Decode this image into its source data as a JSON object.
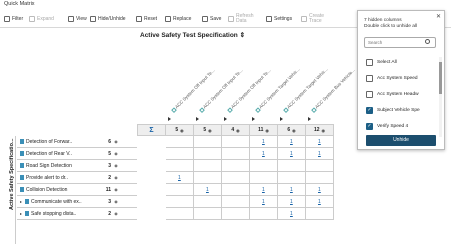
{
  "window": {
    "title": "Quick Matrix"
  },
  "toolbar": {
    "items": [
      {
        "label": "Filter",
        "icon": "filter-icon",
        "enabled": true
      },
      {
        "label": "Expand",
        "icon": "expand-icon",
        "enabled": false
      },
      {
        "label": "View",
        "icon": "view-icon",
        "enabled": true
      },
      {
        "label": "Hide/Unhide",
        "icon": "eye-slash-icon",
        "enabled": true
      },
      {
        "label": "Reset",
        "icon": "reset-icon",
        "enabled": true
      },
      {
        "label": "Replace",
        "icon": "replace-icon",
        "enabled": true
      },
      {
        "label": "Save",
        "icon": "save-icon",
        "enabled": true
      },
      {
        "label": "Refresh Data",
        "icon": "refresh-icon",
        "enabled": false
      },
      {
        "label": "Settings",
        "icon": "gear-icon",
        "enabled": true
      },
      {
        "label": "Create Trace",
        "icon": "trace-icon",
        "enabled": false
      }
    ]
  },
  "matrix": {
    "column_spec_title": "Active Safety Test Specification",
    "column_labels": [
      "ACC System Off Input Te...",
      "ACC System Off Input Te...",
      "ACC System Off Input Te...",
      "ACC System Target Vehic...",
      "ACC System Target Vehic...",
      "ACC System Bus Vehicle..."
    ],
    "column_counts": [
      "5",
      "5",
      "4",
      "11",
      "6",
      "12"
    ],
    "sigma": "Σ",
    "row_axis_label": "Active Safety Specificatio...",
    "rows": [
      {
        "name": "Detection of Forwar..",
        "count": "6",
        "expander": ""
      },
      {
        "name": "Detection of Rear V..",
        "count": "5",
        "expander": ""
      },
      {
        "name": "Road Sign Detection",
        "count": "3",
        "expander": ""
      },
      {
        "name": "Provide alert to dr..",
        "count": "2",
        "expander": ""
      },
      {
        "name": "Collision Detection",
        "count": "11",
        "expander": ""
      },
      {
        "name": "Communicate with ex..",
        "count": "3",
        "expander": "▸"
      },
      {
        "name": "Safe stopping dista..",
        "count": "2",
        "expander": "▸"
      }
    ],
    "cell_values": [
      {
        "row": 0,
        "col": 3,
        "value": "1"
      },
      {
        "row": 0,
        "col": 4,
        "value": "1"
      },
      {
        "row": 0,
        "col": 5,
        "value": "1"
      },
      {
        "row": 1,
        "col": 3,
        "value": "1"
      },
      {
        "row": 1,
        "col": 4,
        "value": "1"
      },
      {
        "row": 1,
        "col": 5,
        "value": "1"
      },
      {
        "row": 3,
        "col": 0,
        "value": "1"
      },
      {
        "row": 4,
        "col": 1,
        "value": "1"
      },
      {
        "row": 4,
        "col": 3,
        "value": "1"
      },
      {
        "row": 4,
        "col": 4,
        "value": "1"
      },
      {
        "row": 4,
        "col": 5,
        "value": "1"
      },
      {
        "row": 5,
        "col": 3,
        "value": "1"
      },
      {
        "row": 5,
        "col": 4,
        "value": "1"
      },
      {
        "row": 5,
        "col": 5,
        "value": "1"
      },
      {
        "row": 6,
        "col": 4,
        "value": "1"
      }
    ]
  },
  "unhide_popup": {
    "close": "✕",
    "message_line1": "7 hidden columns",
    "message_line2": "Double click to unhide all",
    "search_placeholder": "Search",
    "items": [
      {
        "label": "Select All",
        "checked": false
      },
      {
        "label": "Acc System Speed",
        "checked": false
      },
      {
        "label": "Acc System Headw",
        "checked": false
      },
      {
        "label": "Subject Vehicle Spe",
        "checked": true
      },
      {
        "label": "Verify Speed 4",
        "checked": true
      }
    ],
    "button_label": "Unhide"
  },
  "colors": {
    "accent": "#1c4e6e",
    "link": "#1a64a8",
    "checkbox_checked": "#1c5f86",
    "row_icon": "#3a8fb7"
  }
}
